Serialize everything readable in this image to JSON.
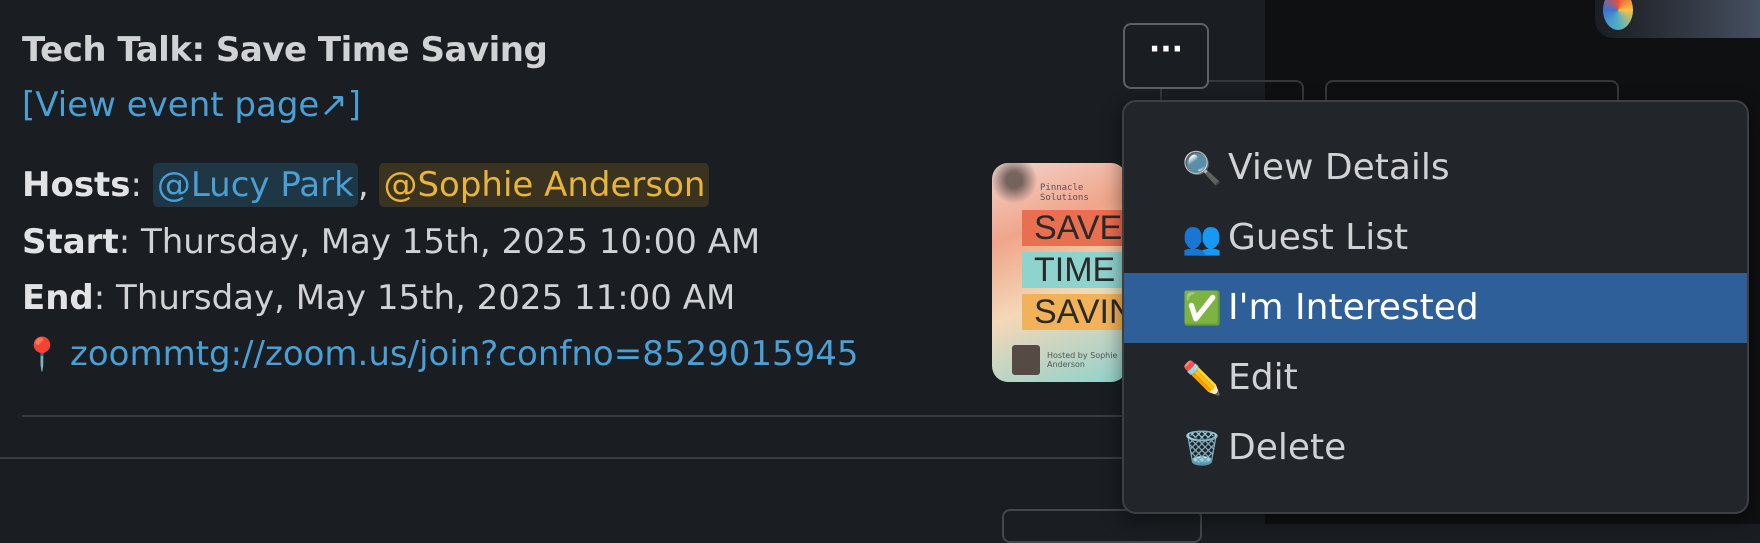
{
  "event": {
    "title": "Tech Talk: Save Time Saving",
    "view_link": "[View event page↗]",
    "hosts_label": "Hosts",
    "hosts": [
      "@Lucy Park",
      "@Sophie Anderson"
    ],
    "start_label": "Start",
    "start_value": ": Thursday, May 15th, 2025 10:00 AM",
    "end_label": "End",
    "end_value": ": Thursday, May 15th, 2025 11:00 AM",
    "location_icon": "pushpin-icon",
    "location_link": "zoommtg://zoom.us/join?confno=8529015945"
  },
  "more_button": {
    "label": "···"
  },
  "poster": {
    "company": "Pinnacle Solutions",
    "lines": [
      "SAVE",
      "TIME",
      "SAVING"
    ],
    "hosted_by": "Hosted by Sophie Anderson"
  },
  "menu": {
    "items": [
      {
        "icon": "🔍",
        "icon_name": "magnifier-icon",
        "label": "View Details"
      },
      {
        "icon": "👥",
        "icon_name": "people-icon",
        "label": "Guest List"
      },
      {
        "icon": "✅",
        "icon_name": "check-icon",
        "label": "I'm Interested",
        "active": true
      },
      {
        "icon": "✏️",
        "icon_name": "pencil-icon",
        "label": "Edit"
      },
      {
        "icon": "🗑️",
        "icon_name": "trash-icon",
        "label": "Delete"
      }
    ]
  },
  "colors": {
    "background": "#1a1d21",
    "link": "#4a9fd5",
    "mention_blue": "#4a9fd5",
    "mention_yellow": "#e8b43c",
    "menu_active": "#2f5f98"
  }
}
